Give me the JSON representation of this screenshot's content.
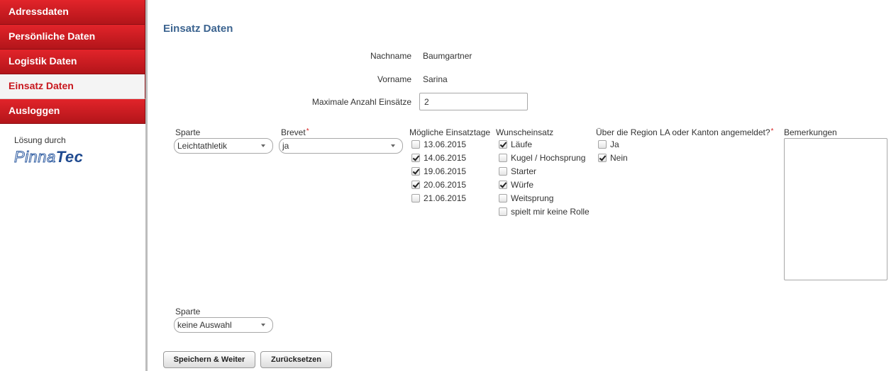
{
  "sidebar": {
    "items": [
      {
        "label": "Adressdaten"
      },
      {
        "label": "Persönliche Daten"
      },
      {
        "label": "Logistik Daten"
      },
      {
        "label": "Einsatz Daten"
      },
      {
        "label": "Ausloggen"
      }
    ],
    "credit": "Lösung durch",
    "logo": {
      "part1": "Pinna",
      "part2": "Tec"
    }
  },
  "main": {
    "title": "Einsatz Daten",
    "nachname": {
      "label": "Nachname",
      "value": "Baumgartner"
    },
    "vorname": {
      "label": "Vorname",
      "value": "Sarina"
    },
    "max_einsaetze": {
      "label": "Maximale Anzahl Einsätze",
      "value": "2"
    },
    "sparte": {
      "label": "Sparte",
      "value": "Leichtathletik"
    },
    "brevet": {
      "label": "Brevet",
      "required": "*",
      "value": "ja"
    },
    "einsatztage": {
      "label": "Mögliche Einsatztage",
      "options": [
        {
          "label": "13.06.2015",
          "checked": false
        },
        {
          "label": "14.06.2015",
          "checked": true
        },
        {
          "label": "19.06.2015",
          "checked": true
        },
        {
          "label": "20.06.2015",
          "checked": true
        },
        {
          "label": "21.06.2015",
          "checked": false
        }
      ]
    },
    "wunscheinsatz": {
      "label": "Wunscheinsatz",
      "options": [
        {
          "label": "Läufe",
          "checked": true
        },
        {
          "label": "Kugel / Hochsprung",
          "checked": false
        },
        {
          "label": "Starter",
          "checked": false
        },
        {
          "label": "Würfe",
          "checked": true
        },
        {
          "label": "Weitsprung",
          "checked": false
        },
        {
          "label": "spielt mir keine Rolle",
          "checked": false
        }
      ]
    },
    "region": {
      "label": "Über die Region LA oder Kanton angemeldet?",
      "required": "*",
      "options": [
        {
          "label": "Ja",
          "checked": false
        },
        {
          "label": "Nein",
          "checked": true
        }
      ]
    },
    "bemerkungen": {
      "label": "Bemerkungen",
      "value": ""
    },
    "sparte2": {
      "label": "Sparte",
      "value": "keine Auswahl"
    },
    "buttons": {
      "save": "Speichern & Weiter",
      "reset": "Zurücksetzen"
    }
  },
  "colors": {
    "accent": "#d01f25",
    "title": "#3c6490"
  }
}
